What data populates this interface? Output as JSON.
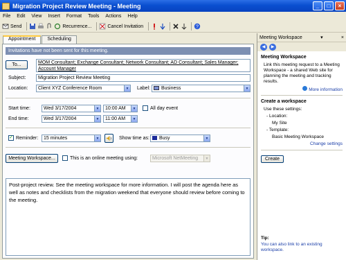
{
  "window": {
    "title": "Migration Project Review Meeting - Meeting"
  },
  "menu": [
    "File",
    "Edit",
    "View",
    "Insert",
    "Format",
    "Tools",
    "Actions",
    "Help"
  ],
  "toolbar": {
    "send": "Send",
    "recurrence": "Recurrence...",
    "cancel_invitation": "Cancel Invitation"
  },
  "tabs": {
    "appointment": "Appointment",
    "scheduling": "Scheduling"
  },
  "form": {
    "info_bar": "Invitations have not been sent for this meeting.",
    "to_button": "To...",
    "attendees_line1": "MOM Consultant; Exchange Consultant; Network Consultant; AD Consultant; Sales Manager;",
    "attendees_line2": "Account Manager",
    "subject_label": "Subject:",
    "subject": "Migration Project Review Meeting",
    "location_label": "Location:",
    "location": "Client XYZ Conference Room",
    "label_label": "Label:",
    "label_value": "Business",
    "start_label": "Start time:",
    "start_date": "Wed 3/17/2004",
    "start_time": "10:00 AM",
    "allday": "All day event",
    "end_label": "End time:",
    "end_date": "Wed 3/17/2004",
    "end_time": "11:00 AM",
    "reminder_label": "Reminder:",
    "reminder": "15 minutes",
    "showtime_label": "Show time as:",
    "showtime": "Busy",
    "workspace_button": "Meeting Workspace...",
    "online": "This is an online meeting using:",
    "online_app": "Microsoft NetMeeting",
    "notes": "Post-project review.  See the meeting workspace for more information. I will post the agenda here as well as notes and checklists from the migration weekend that everyone should review before coming to the meeting."
  },
  "pane": {
    "header": "Meeting Workspace",
    "section1_title": "Meeting Workspace",
    "section1_text": "Link this meeting request to a Meeting Workspace - a shared Web site for planning the meeting and tracking results.",
    "more_info": "More information",
    "section2_title": "Create a workspace",
    "use_settings": "Use these settings:",
    "loc_label": "- Location:",
    "loc_value": "My Site",
    "tpl_label": "- Template:",
    "tpl_value": "Basic Meeting Workspace",
    "change_settings": "Change settings",
    "create": "Create",
    "tip_title": "Tip:",
    "tip_text": "You can also link to an existing workspace."
  },
  "colors": {
    "titlebar": "#0a4fd0",
    "info_bar": "#7d8fb2",
    "business_label": "#7a8fd0",
    "busy": "#1a2a9a"
  }
}
